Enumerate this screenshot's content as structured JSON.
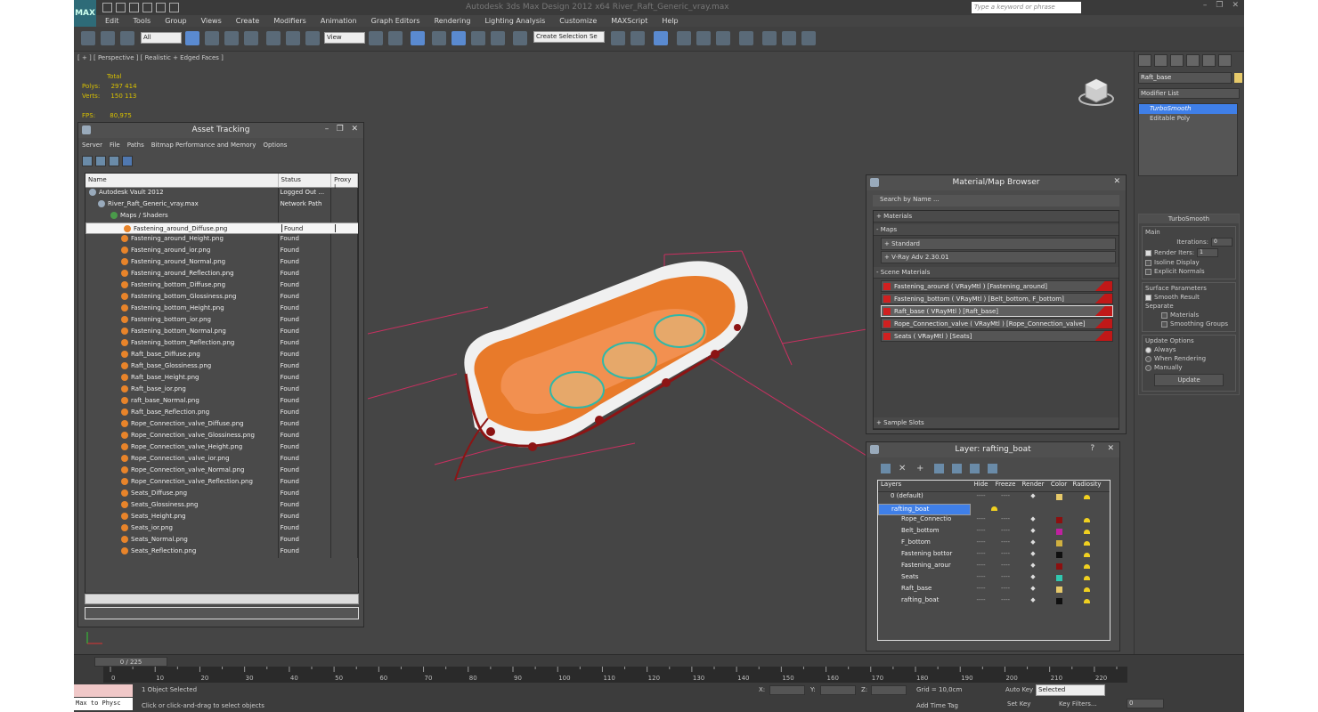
{
  "window": {
    "title": "Autodesk 3ds Max Design 2012 x64    River_Raft_Generic_vray.max",
    "search_placeholder": "Type a keyword or phrase",
    "logo": "MAX"
  },
  "menu": [
    "Edit",
    "Tools",
    "Group",
    "Views",
    "Create",
    "Modifiers",
    "Animation",
    "Graph Editors",
    "Rendering",
    "Lighting Analysis",
    "Customize",
    "MAXScript",
    "Help"
  ],
  "toolbar": {
    "filter": "All",
    "ref_coord": "View",
    "selection_set": "Create Selection Se"
  },
  "viewport": {
    "label": "[ + ] [ Perspective ] [ Realistic + Edged Faces ]",
    "total_label": "Total",
    "polys_label": "Polys:",
    "polys": "297 414",
    "verts_label": "Verts:",
    "verts": "150 113",
    "fps_label": "FPS:",
    "fps": "80,975"
  },
  "asset_tracking": {
    "title": "Asset Tracking",
    "menu": [
      "Server",
      "File",
      "Paths",
      "Bitmap Performance and Memory",
      "Options"
    ],
    "columns": [
      "Name",
      "Status",
      "Proxy I"
    ],
    "rows": [
      {
        "name": "Autodesk Vault 2012",
        "status": "Logged Out ..."
      },
      {
        "name": "River_Raft_Generic_vray.max",
        "status": "Network Path"
      },
      {
        "name": "Maps / Shaders",
        "status": ""
      },
      {
        "name": "Fastening_around_Diffuse.png",
        "status": "Found"
      },
      {
        "name": "Fastening_around_Glossiness.png",
        "status": "Found"
      },
      {
        "name": "Fastening_around_Height.png",
        "status": "Found"
      },
      {
        "name": "Fastening_around_ior.png",
        "status": "Found"
      },
      {
        "name": "Fastening_around_Normal.png",
        "status": "Found"
      },
      {
        "name": "Fastening_around_Reflection.png",
        "status": "Found"
      },
      {
        "name": "Fastening_bottom_Diffuse.png",
        "status": "Found"
      },
      {
        "name": "Fastening_bottom_Glossiness.png",
        "status": "Found"
      },
      {
        "name": "Fastening_bottom_Height.png",
        "status": "Found"
      },
      {
        "name": "Fastening_bottom_ior.png",
        "status": "Found"
      },
      {
        "name": "Fastening_bottom_Normal.png",
        "status": "Found"
      },
      {
        "name": "Fastening_bottom_Reflection.png",
        "status": "Found"
      },
      {
        "name": "Raft_base_Diffuse.png",
        "status": "Found"
      },
      {
        "name": "Raft_base_Glossiness.png",
        "status": "Found"
      },
      {
        "name": "Raft_base_Height.png",
        "status": "Found"
      },
      {
        "name": "Raft_base_ior.png",
        "status": "Found"
      },
      {
        "name": "raft_base_Normal.png",
        "status": "Found"
      },
      {
        "name": "Raft_base_Reflection.png",
        "status": "Found"
      },
      {
        "name": "Rope_Connection_valve_Diffuse.png",
        "status": "Found"
      },
      {
        "name": "Rope_Connection_valve_Glossiness.png",
        "status": "Found"
      },
      {
        "name": "Rope_Connection_valve_Height.png",
        "status": "Found"
      },
      {
        "name": "Rope_Connection_valve_ior.png",
        "status": "Found"
      },
      {
        "name": "Rope_Connection_valve_Normal.png",
        "status": "Found"
      },
      {
        "name": "Rope_Connection_valve_Reflection.png",
        "status": "Found"
      },
      {
        "name": "Seats_Diffuse.png",
        "status": "Found"
      },
      {
        "name": "Seats_Glossiness.png",
        "status": "Found"
      },
      {
        "name": "Seats_Height.png",
        "status": "Found"
      },
      {
        "name": "Seats_ior.png",
        "status": "Found"
      },
      {
        "name": "Seats_Normal.png",
        "status": "Found"
      },
      {
        "name": "Seats_Reflection.png",
        "status": "Found"
      }
    ]
  },
  "material_browser": {
    "title": "Material/Map Browser",
    "search": "Search by Name ...",
    "materials": "+ Materials",
    "maps": "- Maps",
    "standard": "+ Standard",
    "vray": "+ V-Ray Adv 2.30.01",
    "scene": "- Scene Materials",
    "sample": "+ Sample Slots",
    "items": [
      "Fastening_around  ( VRayMtl )  [Fastening_around]",
      "Fastening_bottom  ( VRayMtl )  [Belt_bottom, F_bottom]",
      "Raft_base  ( VRayMtl )  [Raft_base]",
      "Rope_Connection_valve  ( VRayMtl )  [Rope_Connection_valve]",
      "Seats  ( VRayMtl )  [Seats]"
    ]
  },
  "layer": {
    "title": "Layer: rafting_boat",
    "columns": [
      "Layers",
      "Hide",
      "Freeze",
      "Render",
      "Color",
      "Radiosity"
    ],
    "rows": [
      {
        "name": "0 (default)",
        "color": "#e6c96a"
      },
      {
        "name": "rafting_boat",
        "color": "#c8a020"
      },
      {
        "name": "Rope_Connectio",
        "color": "#8c1010"
      },
      {
        "name": "Belt_bottom",
        "color": "#c020a0"
      },
      {
        "name": "F_bottom",
        "color": "#d0b040"
      },
      {
        "name": "Fastening bottor",
        "color": "#101010"
      },
      {
        "name": "Fastening_arour",
        "color": "#8c1010"
      },
      {
        "name": "Seats",
        "color": "#30c8b0"
      },
      {
        "name": "Raft_base",
        "color": "#e6c96a"
      },
      {
        "name": "rafting_boat",
        "color": "#101010"
      }
    ]
  },
  "command_panel": {
    "object_name": "Raft_base",
    "modifier_list": "Modifier List",
    "stack": [
      "TurboSmooth",
      "Editable Poly"
    ],
    "rollout": "TurboSmooth",
    "main": "Main",
    "iterations_label": "Iterations:",
    "iterations": "0",
    "render_iters_label": "Render Iters:",
    "render_iters": "1",
    "isoline": "Isoline Display",
    "explicit": "Explicit Normals",
    "surface": "Surface Parameters",
    "smooth_result": "Smooth Result",
    "separate": "Separate",
    "materials": "Materials",
    "smoothing_groups": "Smoothing Groups",
    "update_options": "Update Options",
    "always": "Always",
    "when_rendering": "When Rendering",
    "manually": "Manually",
    "update": "Update"
  },
  "timeline": {
    "frame": "0 / 225",
    "ticks": [
      "0",
      "10",
      "20",
      "30",
      "40",
      "50",
      "60",
      "70",
      "80",
      "90",
      "100",
      "110",
      "120",
      "130",
      "140",
      "150",
      "160",
      "170",
      "180",
      "190",
      "200",
      "210",
      "220"
    ]
  },
  "status": {
    "maxscript": "Max to Physc",
    "selected": "1 Object Selected",
    "prompt": "Click or click-and-drag to select objects",
    "x_label": "X:",
    "y_label": "Y:",
    "z_label": "Z:",
    "grid": "Grid = 10,0cm",
    "autokey": "Auto Key",
    "selected_dd": "Selected",
    "setkey": "Set Key",
    "keyfilters": "Key Filters...",
    "addtimetag": "Add Time Tag",
    "frame_field": "0"
  }
}
